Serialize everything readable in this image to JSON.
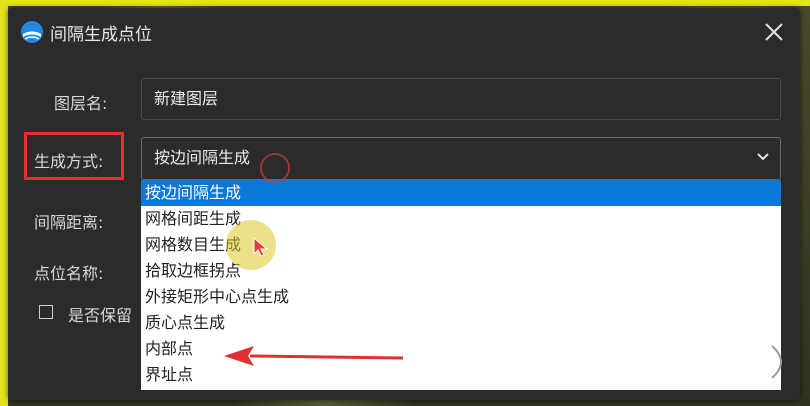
{
  "dialog": {
    "title": "间隔生成点位",
    "close_icon": "close-icon",
    "app_icon": "app-logo-icon"
  },
  "form": {
    "layer_name_label": "图层名:",
    "layer_name_value": "新建图层",
    "method_label": "生成方式:",
    "method_value": "按边间隔生成",
    "interval_label": "间隔距离:",
    "point_name_label": "点位名称:",
    "keep_label": "是否保留"
  },
  "dropdown": {
    "items": [
      "按边间隔生成",
      "网格间距生成",
      "网格数目生成",
      "拾取边框拐点",
      "外接矩形中心点生成",
      "质心点生成",
      "内部点",
      "界址点"
    ],
    "selected_index": 0
  },
  "colors": {
    "highlight": "#0a78d7",
    "annotation_red": "#e03030",
    "dialog_bg": "#2b2b2b",
    "frame_yellow": "#e4e320"
  }
}
